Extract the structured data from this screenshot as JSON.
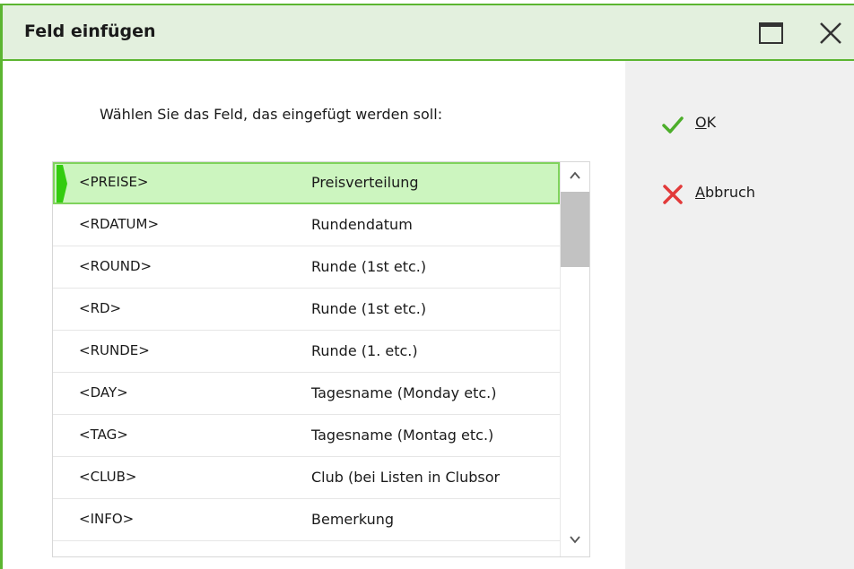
{
  "dialog": {
    "title": "Feld einfügen",
    "prompt": "Wählen Sie das Feld, das eingefügt werden soll:"
  },
  "window_controls": {
    "maximize_icon": "maximize-icon",
    "close_icon": "close-icon"
  },
  "fields": [
    {
      "code": "<PREISE>",
      "description": "Preisverteilung",
      "selected": true
    },
    {
      "code": "<RDATUM>",
      "description": "Rundendatum",
      "selected": false
    },
    {
      "code": "<ROUND>",
      "description": "Runde (1st etc.)",
      "selected": false
    },
    {
      "code": "<RD>",
      "description": "Runde (1st etc.)",
      "selected": false
    },
    {
      "code": "<RUNDE>",
      "description": "Runde (1. etc.)",
      "selected": false
    },
    {
      "code": "<DAY>",
      "description": "Tagesname (Monday etc.)",
      "selected": false
    },
    {
      "code": "<TAG>",
      "description": "Tagesname (Montag etc.)",
      "selected": false
    },
    {
      "code": "<CLUB>",
      "description": "Club (bei Listen in Clubsor",
      "selected": false
    },
    {
      "code": "<INFO>",
      "description": "Bemerkung",
      "selected": false
    }
  ],
  "actions": {
    "ok": {
      "mnemonic": "O",
      "rest": "K"
    },
    "cancel": {
      "mnemonic": "A",
      "rest": "bbruch"
    }
  },
  "colors": {
    "accent": "#5cb531",
    "titlebar_bg": "#e3f0de",
    "selected_row_bg": "#ccf5bf",
    "ok_icon": "#4cae2a",
    "cancel_icon": "#e23a3a"
  }
}
